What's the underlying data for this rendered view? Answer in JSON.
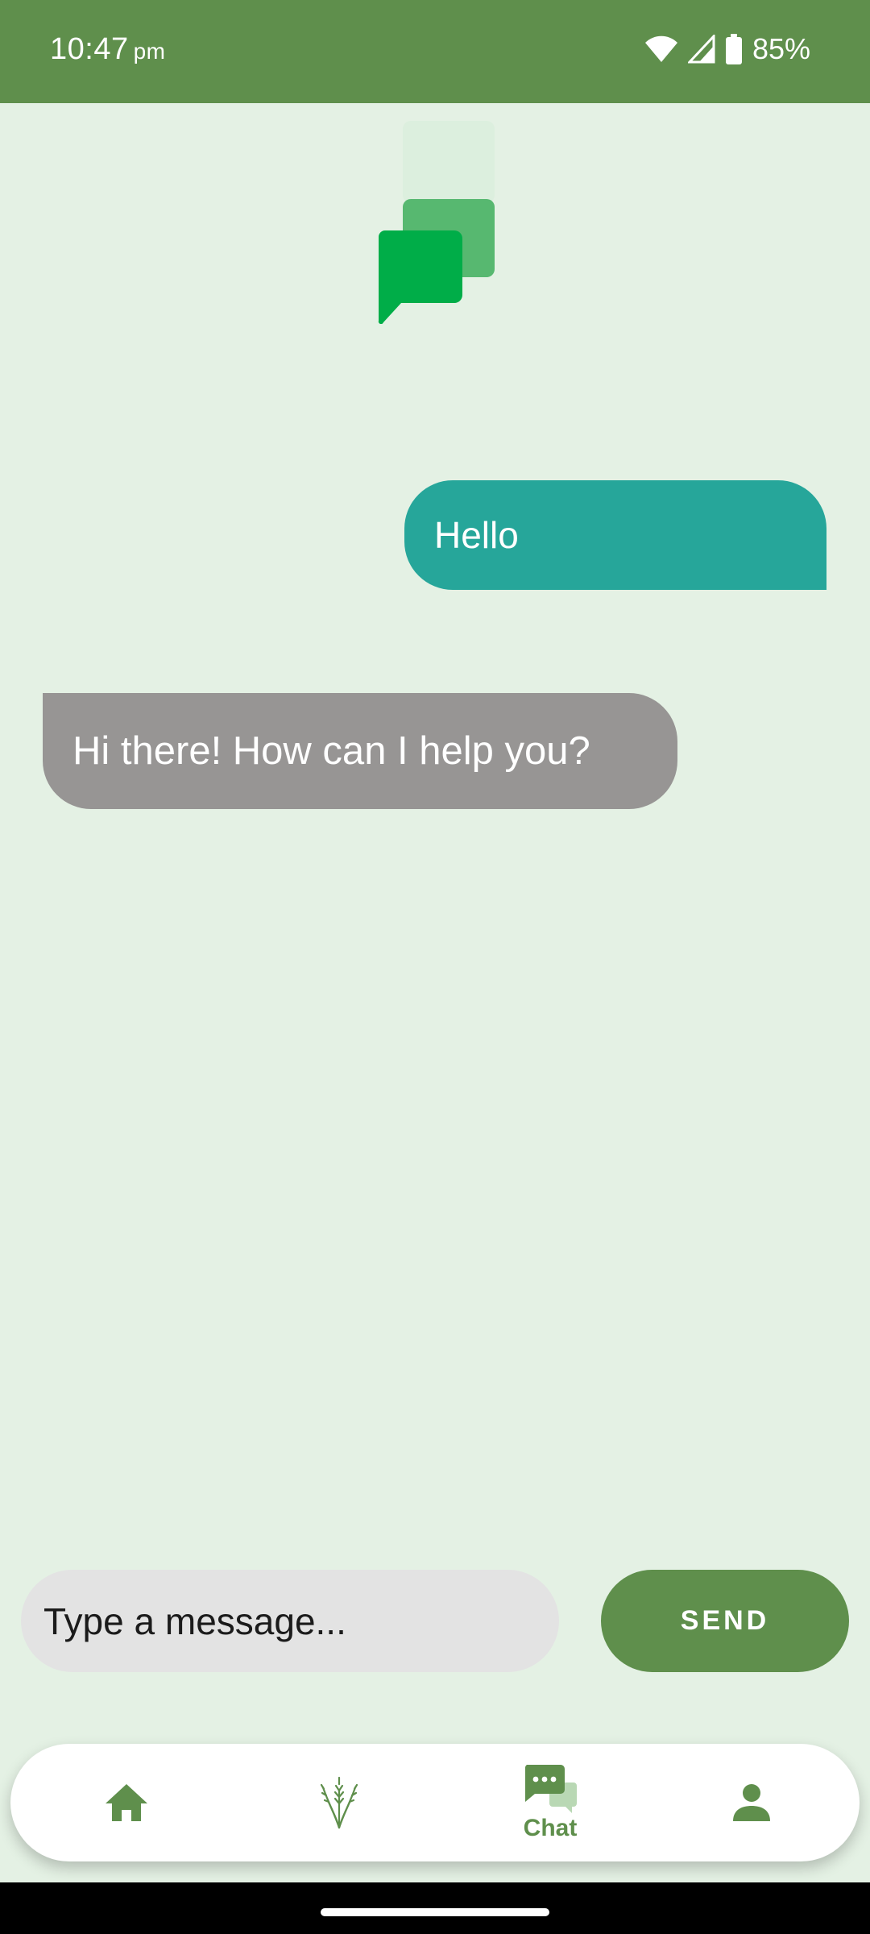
{
  "status_bar": {
    "time": "10:47",
    "ampm": "pm",
    "battery_percent": "85%",
    "icons": [
      "wifi-icon",
      "signal-icon",
      "battery-icon"
    ]
  },
  "logo": {
    "icon": "chat-bubbles-logo"
  },
  "messages": [
    {
      "sender": "user",
      "text": "Hello"
    },
    {
      "sender": "bot",
      "text": "Hi there! How can I help you?"
    }
  ],
  "composer": {
    "placeholder": "Type a message...",
    "send_label": "SEND"
  },
  "bottom_nav": {
    "items": [
      {
        "icon": "home-icon",
        "label": ""
      },
      {
        "icon": "wheat-plant-icon",
        "label": ""
      },
      {
        "icon": "chat-icon",
        "label": "Chat",
        "active": true
      },
      {
        "icon": "profile-icon",
        "label": ""
      }
    ]
  },
  "colors": {
    "primary": "#5f8f4c",
    "background": "#e4f1e4",
    "user_bubble": "#26a69a",
    "bot_bubble": "#979594",
    "input_bg": "#e3e3e3"
  }
}
